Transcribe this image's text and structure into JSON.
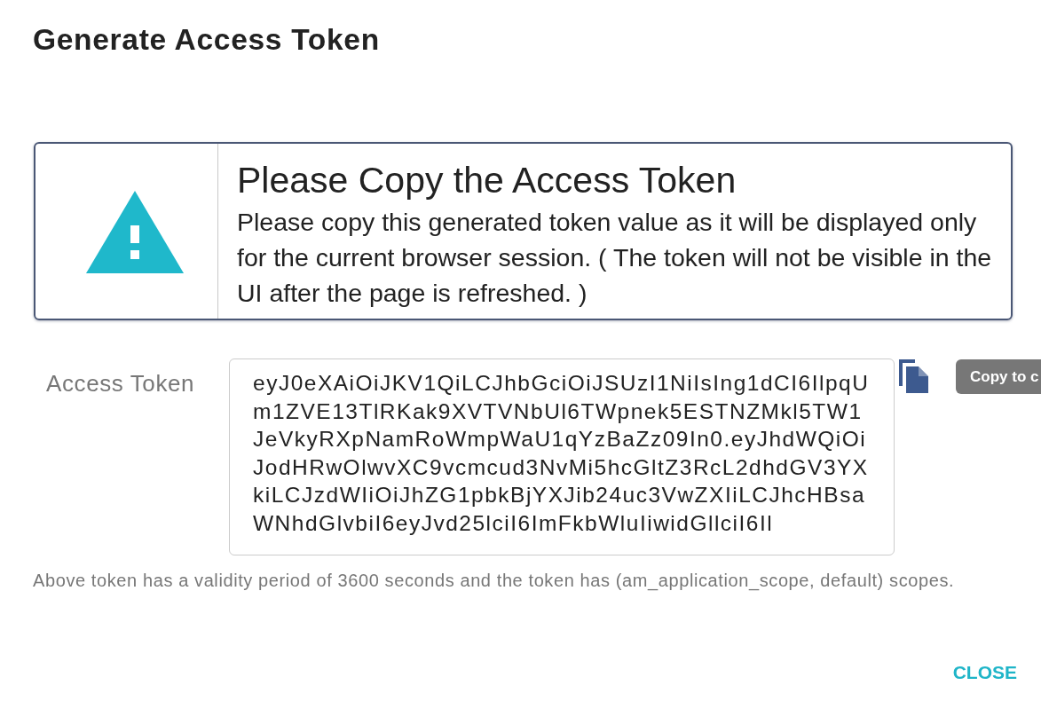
{
  "dialog": {
    "title": "Generate Access Token"
  },
  "alert": {
    "heading": "Please Copy the Access Token",
    "message": "Please copy this generated token value as it will be displayed only for the current browser session. ( The token will not be visible in the UI after the page is refreshed. )"
  },
  "token_field": {
    "label": "Access Token",
    "value": "eyJ0eXAiOiJKV1QiLCJhbGciOiJSUzI1NiIsIng1dCI6IlpqUm1ZVE13TlRKak9XVTVNbUl6TWpnek5ESTNZMkl5TW1JeVkyRXpNamRoWmpWaU1qYzBaZz09In0.eyJhdWQiOiJodHRwOlwvXC9vcmcud3NvMi5hcGltZ3RcL2dhdGV3YXkiLCJzdWIiOiJhZG1pbkBjYXJib24uc3VwZXIiLCJhcHBsaWNhdGlvbiI6eyJvd25lciI6ImFkbWluIiwidGllciI6Il",
    "copy_tooltip": "Copy to c"
  },
  "note": "Above token has a validity period of 3600 seconds and the token has (am_application_scope, default) scopes.",
  "buttons": [
    {
      "label": "CLOSE"
    }
  ]
}
